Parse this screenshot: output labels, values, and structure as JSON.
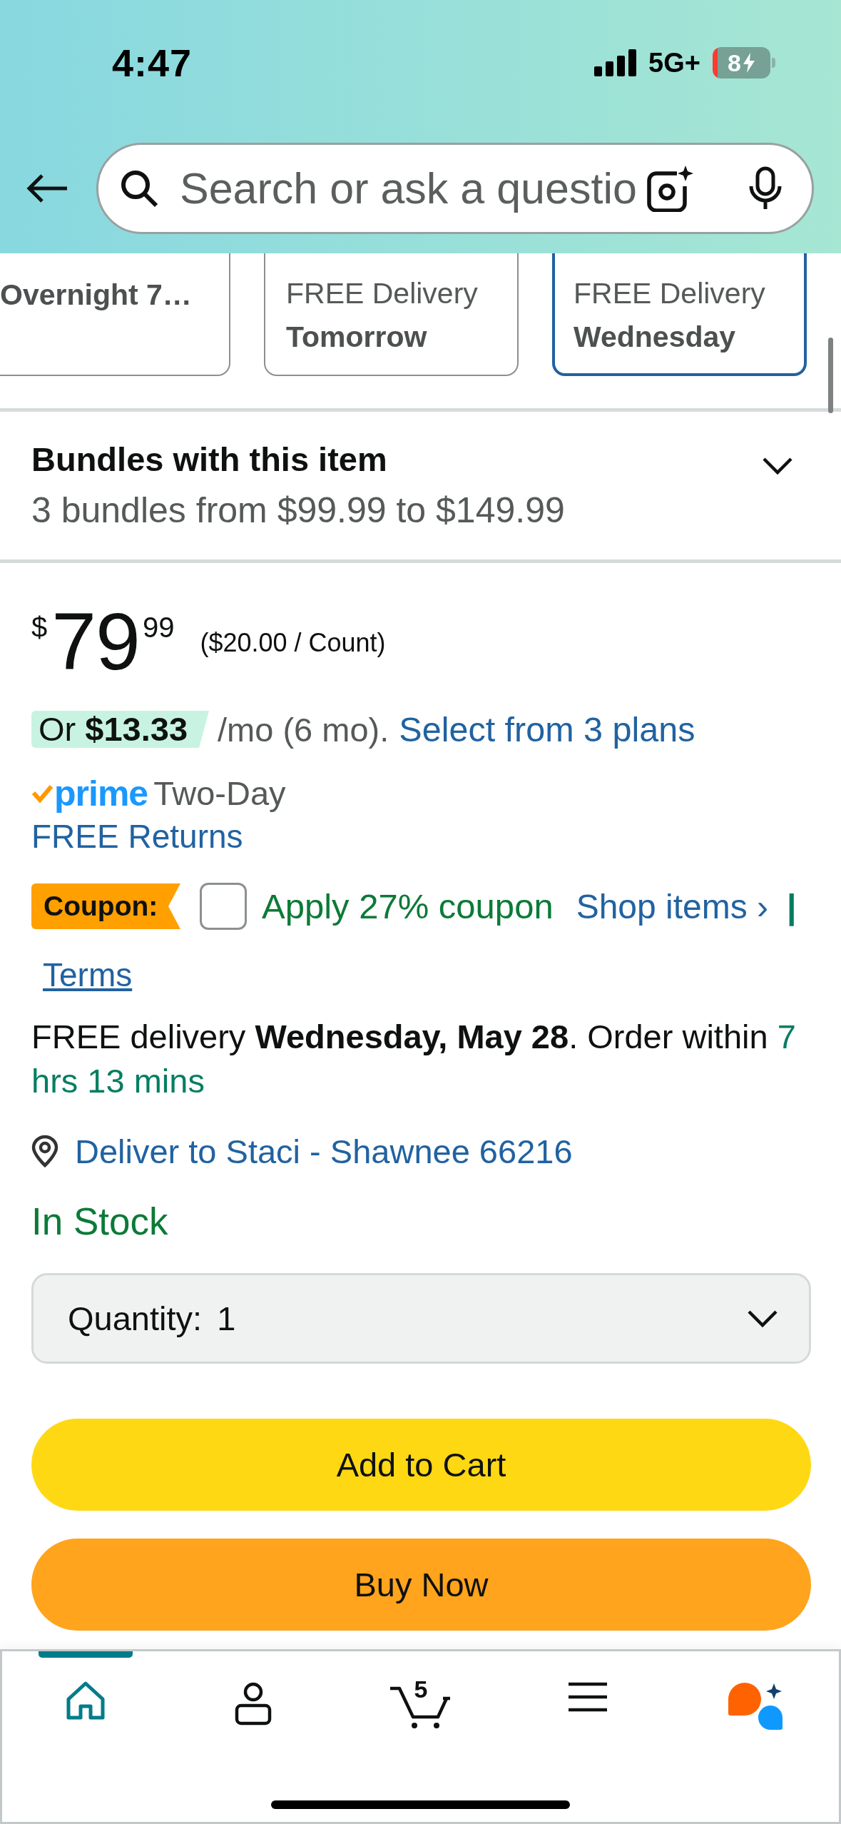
{
  "status_bar": {
    "time": "4:47",
    "network": "5G+",
    "battery": "8"
  },
  "search": {
    "placeholder": "Search or ask a questio"
  },
  "delivery_options": [
    {
      "date": "Overnight 7…",
      "selected": false
    },
    {
      "label": "FREE Delivery",
      "date": "Tomorrow",
      "selected": false
    },
    {
      "label": "FREE Delivery",
      "date": "Wednesday",
      "selected": true
    }
  ],
  "bundles": {
    "title": "Bundles with this item",
    "subtitle": "3 bundles from $99.99 to $149.99",
    "expanded": false
  },
  "price": {
    "currency": "$",
    "whole": "79",
    "fraction": "99",
    "unit_price": "($20.00 / Count)"
  },
  "installment": {
    "amount": "Or **$13.33**",
    "terms": "/mo (6 mo).",
    "link": "Select from 3 plans"
  },
  "prime": {
    "logo": "prime",
    "speed": "Two-Day"
  },
  "returns_link": "FREE Returns",
  "coupon": {
    "tag": "Coupon:",
    "checked": false,
    "label": "Apply 27% coupon",
    "shop_link": "Shop items ›",
    "separator": "|",
    "terms_link": "Terms"
  },
  "delivery": {
    "text": "FREE delivery **Wednesday, May 28**. Order within",
    "countdown": "7 hrs 13 mins"
  },
  "location": "Deliver to Staci - Shawnee 66216",
  "stock": "In Stock",
  "quantity": {
    "label": "Quantity:",
    "value": "1"
  },
  "buttons": [
    {
      "kind": "cart",
      "label": "Add to Cart"
    },
    {
      "kind": "buy",
      "label": "Buy Now"
    }
  ],
  "nav": [
    {
      "kind": "home",
      "selected": true
    },
    {
      "kind": "account",
      "selected": false
    },
    {
      "kind": "cart",
      "selected": false,
      "badge": "5"
    },
    {
      "kind": "menu",
      "selected": false
    },
    {
      "kind": "assistant",
      "selected": false
    }
  ]
}
